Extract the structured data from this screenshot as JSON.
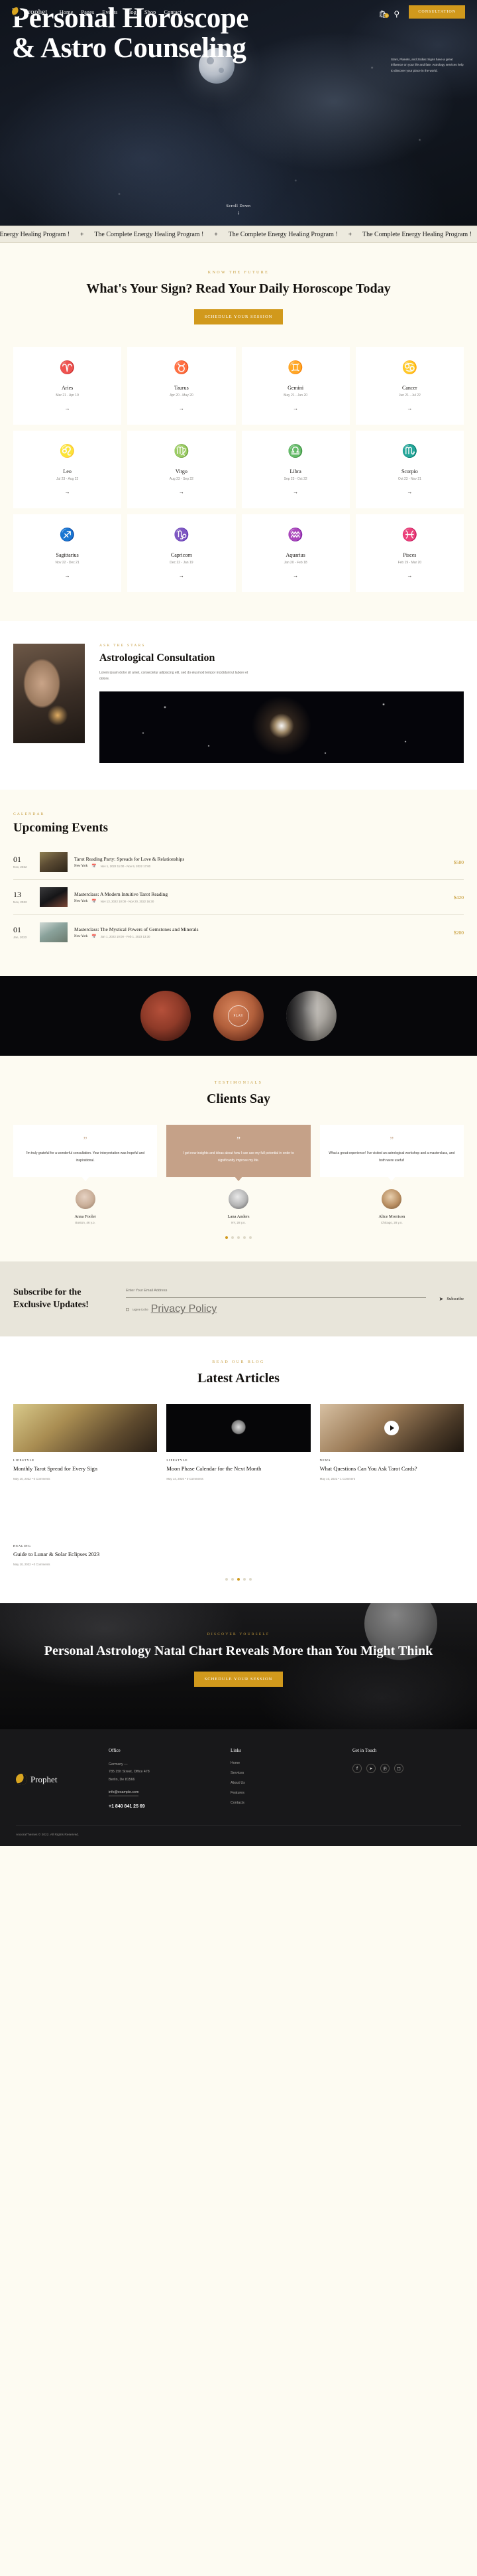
{
  "nav": {
    "brand": "Prophet",
    "links": [
      "Home",
      "Pages",
      "Events",
      "Blog",
      "Shop",
      "Contact"
    ],
    "cart_count": "0",
    "cta": "CONSULTATION",
    "icons": {
      "cart": "cart-icon",
      "search": "search-icon"
    }
  },
  "hero": {
    "title": "Personal Horoscope & Astro Counseling",
    "description": "Stars, Planets, and Zodiac Signs have a great influence on your life and fate. Astrology services help to discover your place in the world.",
    "scroll_label": "Scroll Down"
  },
  "marquee": {
    "item": "The Complete Energy Healing Program !",
    "separator": "+"
  },
  "signs_section": {
    "eyebrow": "KNOW THE FUTURE",
    "title": "What's Your Sign? Read Your Daily Horoscope Today",
    "cta": "SCHEDULE YOUR SESSION",
    "signs": [
      {
        "glyph": "♈",
        "name": "Aries",
        "dates": "Mar 21 - Apr 19"
      },
      {
        "glyph": "♉",
        "name": "Taurus",
        "dates": "Apr 20 - May 20"
      },
      {
        "glyph": "♊",
        "name": "Gemini",
        "dates": "May 21 - Jun 20"
      },
      {
        "glyph": "♋",
        "name": "Cancer",
        "dates": "Jun 21 - Jul 22"
      },
      {
        "glyph": "♌",
        "name": "Leo",
        "dates": "Jul 23 - Aug 22"
      },
      {
        "glyph": "♍",
        "name": "Virgo",
        "dates": "Aug 23 - Sep 22"
      },
      {
        "glyph": "♎",
        "name": "Libra",
        "dates": "Sep 23 - Oct 22"
      },
      {
        "glyph": "♏",
        "name": "Scorpio",
        "dates": "Oct 23 - Nov 21"
      },
      {
        "glyph": "♐",
        "name": "Sagittarius",
        "dates": "Nov 22 - Dec 21"
      },
      {
        "glyph": "♑",
        "name": "Capricorn",
        "dates": "Dec 22 - Jan 19"
      },
      {
        "glyph": "♒",
        "name": "Aquarius",
        "dates": "Jan 20 - Feb 18"
      },
      {
        "glyph": "♓",
        "name": "Pisces",
        "dates": "Feb 19 - Mar 20"
      }
    ],
    "arrow": "→"
  },
  "consultation": {
    "eyebrow": "ASK THE STARS",
    "title": "Astrological Consultation",
    "text": "Lorem ipsum dolor sit amet, consectetur adipiscing elit, sed do eiusmod tempor incididunt ut labore et dolore."
  },
  "events": {
    "eyebrow": "CALENDAR",
    "title": "Upcoming Events",
    "items": [
      {
        "day": "01",
        "month": "Nov, 2022",
        "name": "Tarot Reading Party: Spreads for Love & Relationships",
        "location": "New York",
        "when": "Nov 1, 2022 11:00  -  Nov 9, 2022 17:00",
        "price": "$580"
      },
      {
        "day": "13",
        "month": "Nov, 2022",
        "name": "Masterclass: A Modern Intuitive Tarot Reading",
        "location": "New York",
        "when": "Nov 13, 2022 10:00  -  Nov 20, 2022 16:30",
        "price": "$420"
      },
      {
        "day": "01",
        "month": "Jan, 2023",
        "name": "Masterclass: The Mystical Powers of Gemstones and Minerals",
        "location": "New York",
        "when": "Jan 1, 2023 10:00  -  Feb 1, 2023 13:30",
        "price": "$200"
      }
    ]
  },
  "moon_banner": {
    "play_label": "PLAY"
  },
  "testimonials": {
    "eyebrow": "TESTIMONIALS",
    "title": "Clients Say",
    "quote_mark": "”",
    "items": [
      {
        "text": "I'm truly grateful for a wonderful consultation. Your interpretation was hopeful and inspirational.",
        "name": "Anna Fooler",
        "meta": "Boston, 46 y.o."
      },
      {
        "text": "I got new insights and ideas about how I can use my full potential in order to significantly improve my life.",
        "name": "Lana Anders",
        "meta": "NY, 28 y.o."
      },
      {
        "text": "What a great experience! I've visited an astrological workshop and a masterclass, and both were useful!",
        "name": "Alice Morrison",
        "meta": "Chicago, 28 y.o."
      }
    ],
    "dot_count": 5,
    "active_dot": 0
  },
  "subscribe": {
    "title": "Subscribe for the Exclusive Updates!",
    "placeholder": "Enter Your Email Address",
    "consent_prefix": "I agree to the ",
    "consent_link": "Privacy Policy",
    "button": "Subscribe",
    "send_icon": "send-icon"
  },
  "articles": {
    "eyebrow": "READ OUR BLOG",
    "title": "Latest Articles",
    "items": [
      {
        "category": "LIFESTYLE",
        "title": "Monthly Tarot Spread for Every Sign",
        "date": "May 10, 2022",
        "comments": "0 Comments",
        "has_play": false
      },
      {
        "category": "LIFESTYLE",
        "title": "Moon Phase Calendar for the Next Month",
        "date": "May 14, 2020",
        "comments": "0 Comments",
        "has_play": false
      },
      {
        "category": "NEWS",
        "title": "What Questions Can You Ask Tarot Cards?",
        "date": "May 10, 2022",
        "comments": "1 Comment",
        "has_play": true
      },
      {
        "category": "HEALING",
        "title": "Guide to Lunar & Solar Eclipses 2023",
        "date": "May 10, 2022",
        "comments": "0 Comments",
        "has_play": false
      }
    ],
    "dot_count": 5,
    "active_dot": 2,
    "separator": "•"
  },
  "cta_banner": {
    "eyebrow": "DISCOVER YOURSELF",
    "title": "Personal Astrology Natal Chart Reveals More than You Might Think",
    "button": "SCHEDULE YOUR SESSION"
  },
  "footer": {
    "brand": "Prophet",
    "office": {
      "heading": "Office",
      "line1": "Germany —",
      "line2": "785 15h Street, Office 478",
      "line3": "Berlin, De 81566",
      "email": "info@example.com",
      "phone": "+1 840 841 25 69"
    },
    "links": {
      "heading": "Links",
      "items": [
        "Home",
        "Services",
        "About Us",
        "Features",
        "Contacts"
      ]
    },
    "social": {
      "heading": "Get in Touch",
      "items": [
        "f",
        "➤",
        "Ⓟ",
        "□"
      ]
    },
    "copyright": "AncoraThemes © 2022. All Rights Reserved."
  },
  "colors": {
    "gold": "#d1991c",
    "accent_gold": "#c59b3c",
    "cream": "#fdfbf2",
    "dark": "#18181a",
    "featured": "#c5a188"
  }
}
